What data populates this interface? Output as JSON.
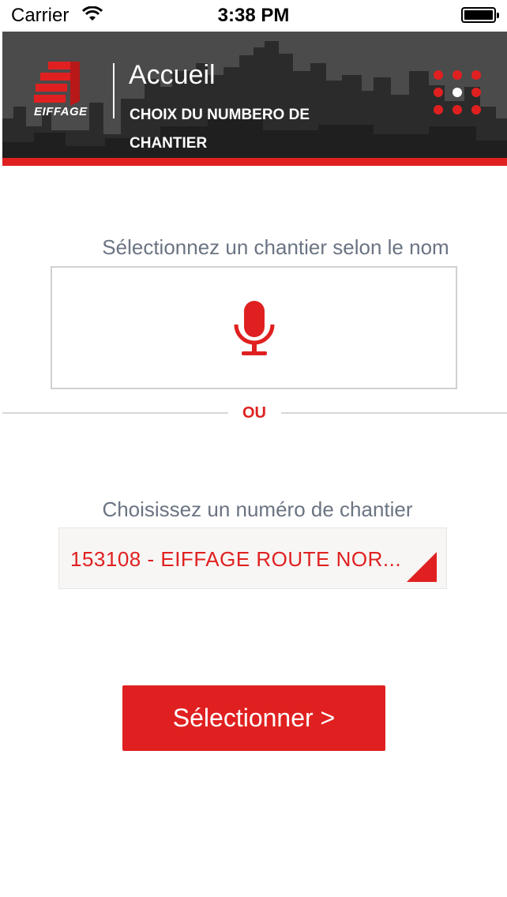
{
  "status_bar": {
    "carrier": "Carrier",
    "time": "3:38 PM",
    "wifi_icon": "wifi-icon",
    "battery_icon": "battery-icon"
  },
  "header": {
    "logo_text": "EIFFAGE",
    "title": "Accueil",
    "subtitle": "CHOIX DU NUMBERO DE CHANTIER",
    "menu_icon": "grid-dots-icon",
    "accent_color": "#e02020"
  },
  "voice_section": {
    "label": "Sélectionnez un chantier selon le nom",
    "icon": "microphone-icon"
  },
  "separator": {
    "text": "OU"
  },
  "site_section": {
    "label": "Choisissez un numéro de chantier",
    "selected_value": "153108 - EIFFAGE ROUTE NOR..."
  },
  "actions": {
    "select_label": "Sélectionner >"
  }
}
